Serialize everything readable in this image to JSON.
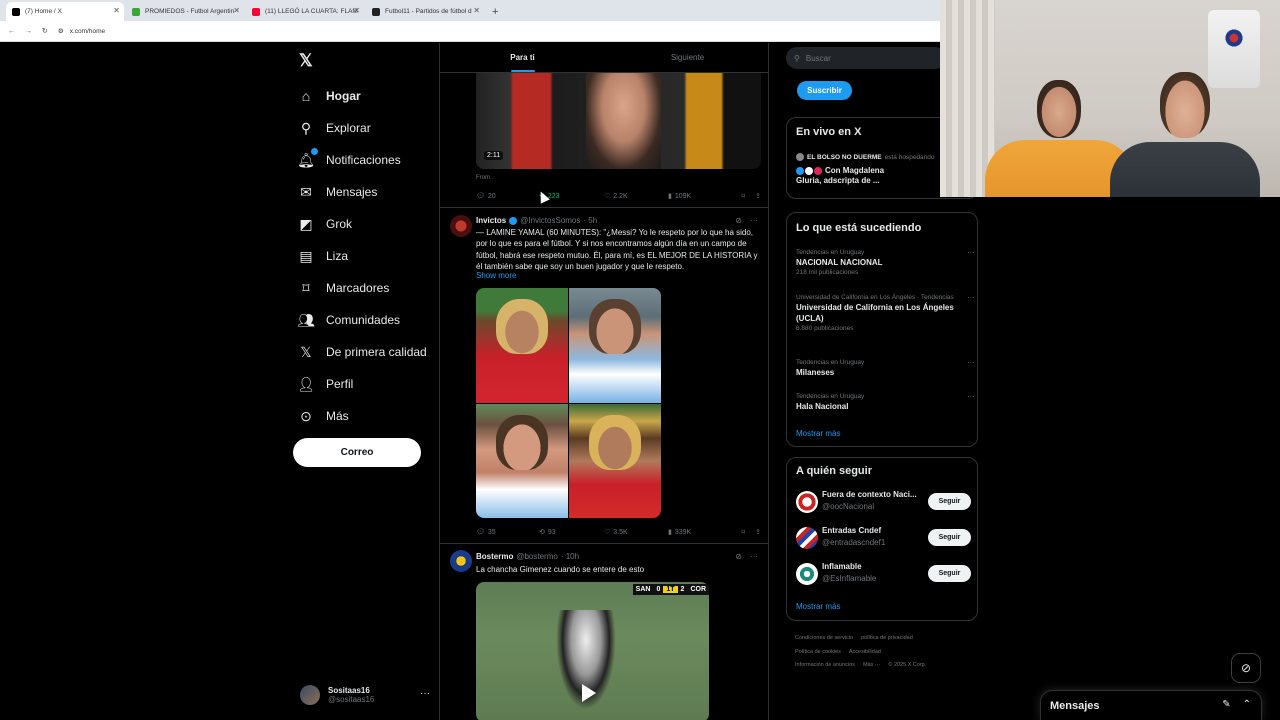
{
  "browser": {
    "tabs": [
      {
        "title": "(7) Home / X",
        "favicon_color": "#000000",
        "active": true
      },
      {
        "title": "PROMIEDOS - Futbol Argentin",
        "favicon_color": "#3aa635",
        "active": false
      },
      {
        "title": "(11) LLEGÓ LA CUARTA: FLAM",
        "favicon_color": "#ff0033",
        "active": false
      },
      {
        "title": "Futbol11 - Partidos de fútbol d",
        "favicon_color": "#222222",
        "active": false
      }
    ],
    "new_tab": "+",
    "url": "x.com/home"
  },
  "sidebar": {
    "logo": "𝕏",
    "nav": [
      {
        "label": "Hogar",
        "icon": "home-icon",
        "glyph": "⌂",
        "active": true
      },
      {
        "label": "Explorar",
        "icon": "search-icon",
        "glyph": "⚲"
      },
      {
        "label": "Notificaciones",
        "icon": "bell-icon",
        "glyph": "🔔︎",
        "badge": true
      },
      {
        "label": "Mensajes",
        "icon": "envelope-icon",
        "glyph": "✉"
      },
      {
        "label": "Grok",
        "icon": "grok-icon",
        "glyph": "◩"
      },
      {
        "label": "Liza",
        "icon": "list-icon",
        "glyph": "▤"
      },
      {
        "label": "Marcadores",
        "icon": "bookmark-icon",
        "glyph": "⌑"
      },
      {
        "label": "Comunidades",
        "icon": "people-icon",
        "glyph": "👥︎"
      },
      {
        "label": "De primera calidad",
        "icon": "x-premium-icon",
        "glyph": "𝕏"
      },
      {
        "label": "Perfil",
        "icon": "person-icon",
        "glyph": "👤︎"
      },
      {
        "label": "Más",
        "icon": "more-circle-icon",
        "glyph": "⊙"
      }
    ],
    "post_button": "Correo",
    "account": {
      "name": "Sositaas16",
      "handle": "@sositaas16",
      "more": "···"
    }
  },
  "feed": {
    "tabs": [
      "Para ti",
      "Siguiente"
    ],
    "tweet1": {
      "duration": "2:11",
      "from": "From .",
      "stats": {
        "replies": "20",
        "retweets": "223",
        "likes": "2.2K",
        "views": "109K"
      }
    },
    "tweet2": {
      "name": "Invictos",
      "handle": "@InvictosSomos",
      "time": "· 5h",
      "text": "— LAMINE YAMAL (60 MINUTES): \"¿Messi? Yo le respeto por lo que ha sido, por lo que es para el fútbol. Y si nos encontramos algún día en un campo de fútbol, habrá ese respeto mutuo. Él, para mí, es EL MEJOR DE LA HISTORIA y él también sabe que soy un buen jugador y que le respeto.",
      "show_more": "Show more",
      "stats": {
        "replies": "35",
        "retweets": "93",
        "likes": "3.5K",
        "views": "339K"
      }
    },
    "tweet3": {
      "name": "Bostermo",
      "handle": "@bostermo",
      "time": "· 10h",
      "text": "La chancha Gimenez cuando se entere de esto",
      "score": {
        "home": "SAN",
        "home_goals": "0",
        "period": "1T",
        "away_goals": "2",
        "away": "COR"
      }
    }
  },
  "right": {
    "search_placeholder": "Buscar",
    "subscribe": "Suscribir",
    "live": {
      "title": "En vivo en X",
      "host": "EL BOLSO NO DUERME",
      "host_suffix": "está hospedando",
      "event": "Con Magdalena Gluria, adscripta de ..."
    },
    "trends": {
      "title": "Lo que está sucediendo",
      "items": [
        {
          "context": "Tendencias en Uruguay",
          "name": "NACIONAL NACIONAL",
          "count": "218 mil publicaciones"
        },
        {
          "context": "Universidad de California en Los Ángeles · Tendencias",
          "name": "Universidad de California en Los Ángeles (UCLA)",
          "count": "6.880 publicaciones"
        },
        {
          "context": "Tendencias en Uruguay",
          "name": "Milaneses",
          "count": ""
        },
        {
          "context": "Tendencias en Uruguay",
          "name": "Hala Nacional",
          "count": ""
        }
      ],
      "more": "Mostrar más"
    },
    "follow": {
      "title": "A quién seguir",
      "items": [
        {
          "name": "Fuera de contexto Naci...",
          "handle": "@oocNacional",
          "button": "Seguir"
        },
        {
          "name": "Entradas Cndef",
          "handle": "@entradascndef1",
          "button": "Seguir"
        },
        {
          "name": "Inflamable",
          "handle": "@EsInflamable",
          "button": "Seguir"
        }
      ],
      "more": "Mostrar más"
    },
    "footer": {
      "line1": [
        "Condiciones de servicio",
        "política de privacidad"
      ],
      "line2": [
        "Política de cookies",
        "Accesibilidad"
      ],
      "line3": [
        "Información de anuncios",
        "Más ···",
        "© 2025 X Corp."
      ]
    }
  },
  "messages_bar": {
    "title": "Mensajes"
  },
  "colors": {
    "accent": "#1d9bf0",
    "background": "#000000",
    "border": "#2f3336",
    "muted": "#71767b",
    "retweet_active": "#00ba7c"
  }
}
